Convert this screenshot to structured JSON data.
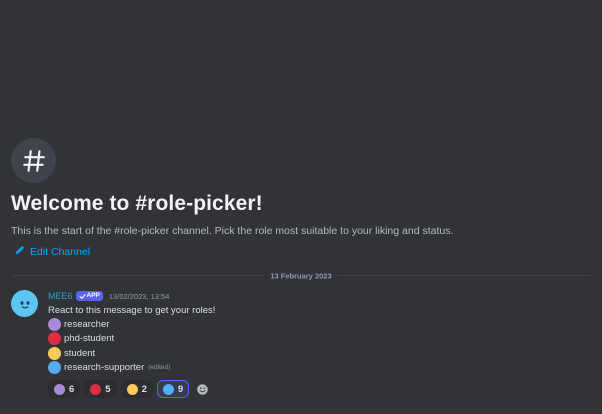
{
  "channel": {
    "hash_symbol": "#",
    "welcome_title": "Welcome to #role-picker!",
    "welcome_description": "This is the start of the #role-picker channel. Pick the role most suitable to your liking and status.",
    "edit_label": "Edit Channel"
  },
  "divider": {
    "date": "13 February 2023"
  },
  "message": {
    "author": "MEE6",
    "badge": "APP",
    "timestamp": "13/02/2023, 13:54",
    "text": "React to this message to get your roles!",
    "roles": [
      {
        "name": "researcher",
        "color": "#a78bd6"
      },
      {
        "name": "phd-student",
        "color": "#dd2e44"
      },
      {
        "name": "student",
        "color": "#fdcb58"
      },
      {
        "name": "research-supporter",
        "color": "#55acee",
        "edited": "(edited)"
      }
    ],
    "reactions": [
      {
        "color": "#a78bd6",
        "count": "6"
      },
      {
        "color": "#dd2e44",
        "count": "5"
      },
      {
        "color": "#fdcb58",
        "count": "2"
      },
      {
        "color": "#55acee",
        "count": "9",
        "active": true
      }
    ]
  },
  "colors": {
    "background": "#313338",
    "link": "#00a8fc",
    "author": "#2aa0c4",
    "badge": "#5865f2"
  }
}
